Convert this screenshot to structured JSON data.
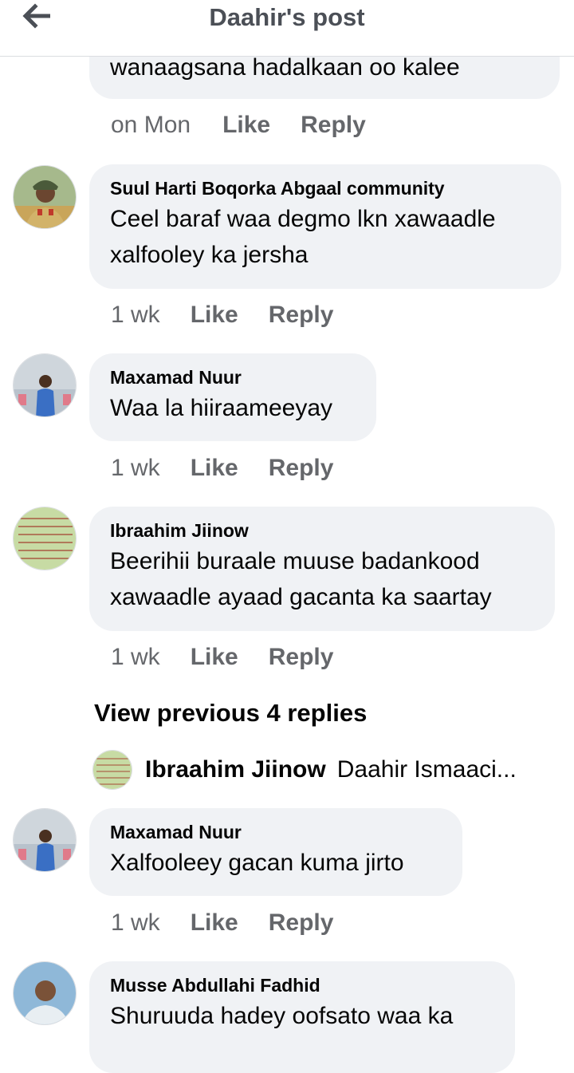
{
  "header": {
    "title": "Daahir's post",
    "back_icon": "arrow-left-icon"
  },
  "comments": [
    {
      "id": "c0",
      "name": "",
      "text": "wanaagsana hadalkaan oo kalee",
      "time": "on Mon",
      "like": "Like",
      "reply": "Reply"
    },
    {
      "id": "c1",
      "name": "Suul Harti Boqorka Abgaal community",
      "text_lines": [
        "Ceel baraf waa degmo lkn xawaadle",
        "xalfooley ka jersha"
      ],
      "time": "1 wk",
      "like": "Like",
      "reply": "Reply"
    },
    {
      "id": "c2",
      "name": "Maxamad Nuur",
      "text": "Waa la hiiraameeyay",
      "time": "1 wk",
      "like": "Like",
      "reply": "Reply"
    },
    {
      "id": "c3",
      "name": "Ibraahim Jiinow",
      "text_lines": [
        "Beerihii buraale muuse badankood",
        "xawaadle ayaad gacanta ka saartay"
      ],
      "time": "1 wk",
      "like": "Like",
      "reply": "Reply"
    },
    {
      "id": "c4",
      "name": "Maxamad Nuur",
      "text": "Xalfooleey gacan kuma jirto",
      "time": "1 wk",
      "like": "Like",
      "reply": "Reply"
    },
    {
      "id": "c5",
      "name": "Musse Abdullahi Fadhid",
      "text": "Shuruuda hadey oofsato waa ka"
    }
  ],
  "view_previous": "View previous 4 replies",
  "reply_preview": {
    "name": "Ibraahim Jiinow",
    "text": "Daahir Ismaaci..."
  }
}
